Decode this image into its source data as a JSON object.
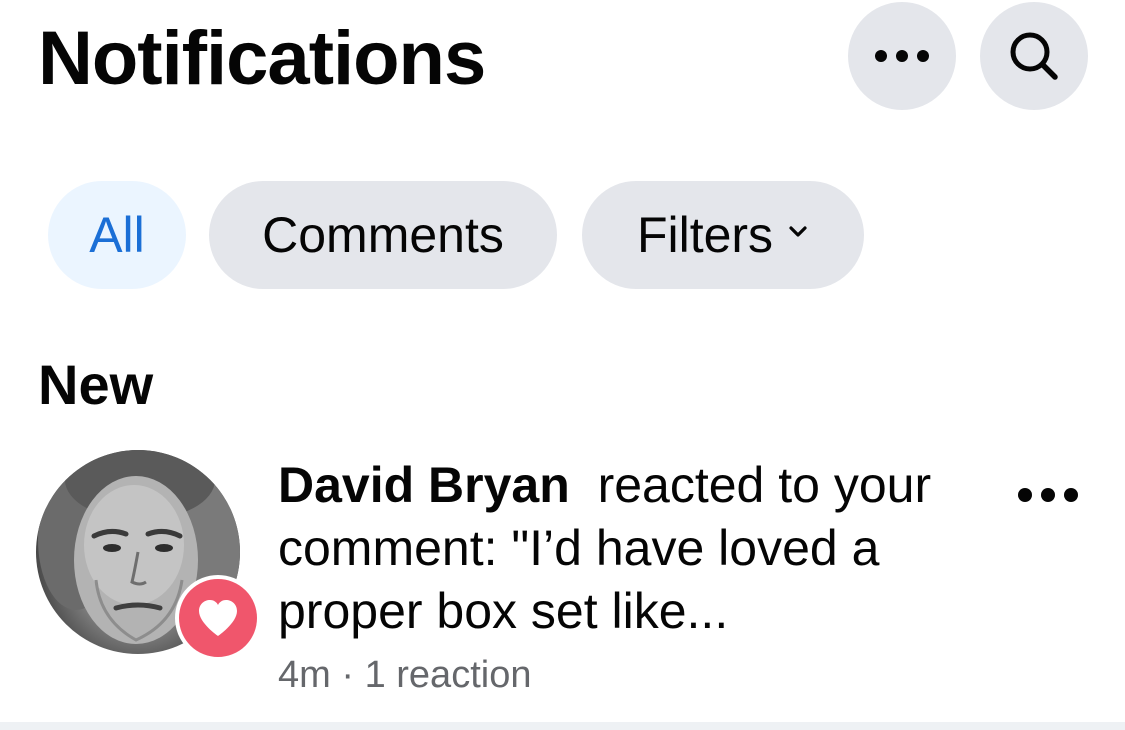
{
  "header": {
    "title": "Notifications",
    "more_icon": "more-horizontal-icon",
    "search_icon": "search-icon"
  },
  "filters": {
    "all_label": "All",
    "comments_label": "Comments",
    "filters_label": "Filters",
    "selected": "All"
  },
  "section": {
    "title": "New"
  },
  "notification": {
    "actor": "David Bryan",
    "action": "reacted to your comment: \"I’d have loved a proper box set like...",
    "time": "4m",
    "separator": "·",
    "reactions": "1 reaction",
    "reaction_type": "heart-icon"
  },
  "colors": {
    "accent": "#1b6fd6",
    "chip_selected_bg": "#ebf5ff",
    "chip_bg": "#e4e6eb",
    "reaction_badge": "#f0566c",
    "meta_text": "#65676b"
  }
}
